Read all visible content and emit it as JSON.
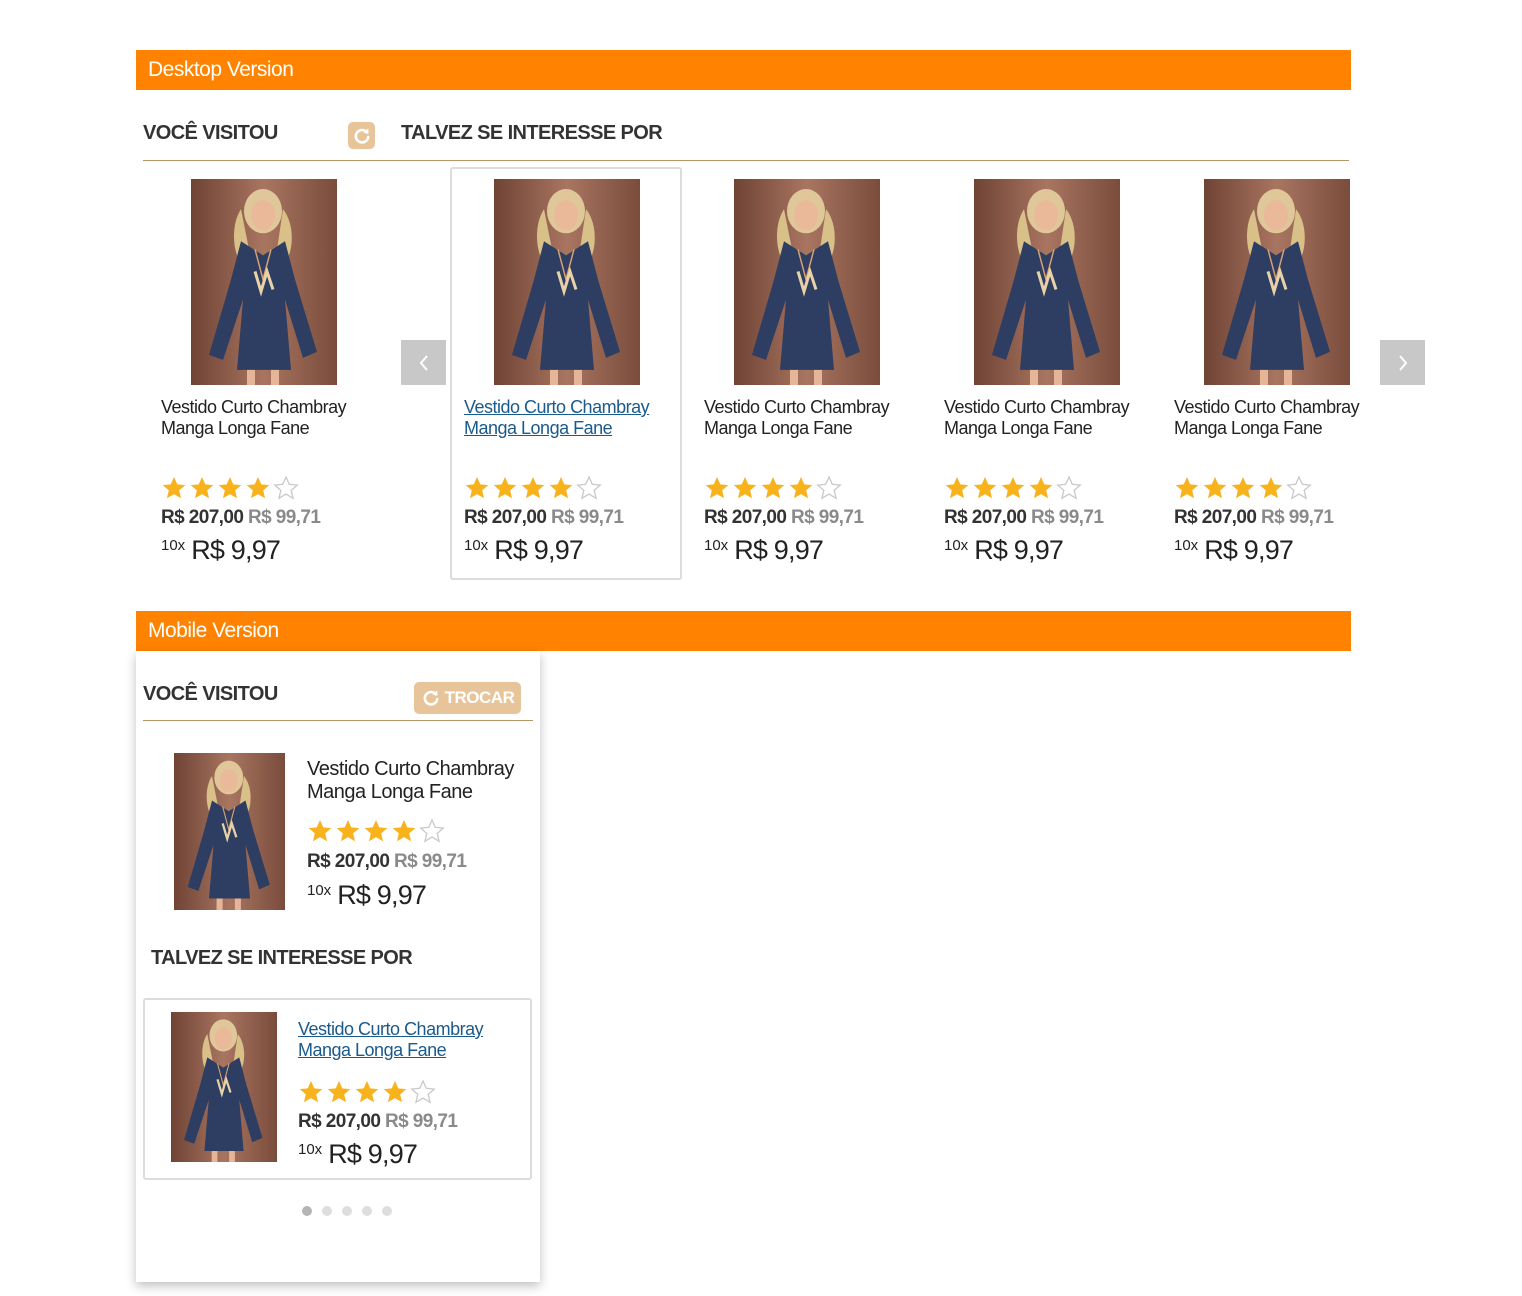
{
  "desktop": {
    "banner": "Desktop Version",
    "visited_heading": "VOCÊ VISITOU",
    "suggest_heading": "TALVEZ SE INTERESSE POR",
    "refresh_icon": "refresh-icon",
    "prev_icon": "chevron-left-icon",
    "next_icon": "chevron-right-icon",
    "products": [
      {
        "name_line1": "Vestido Curto Chambray",
        "name_line2": "Manga Longa Fane",
        "rating": 4,
        "price_old": "R$ 207,00",
        "price_new": "R$ 99,71",
        "installments": "10x",
        "installment_value": "R$ 9,97"
      },
      {
        "name_line1": "Vestido Curto Chambray",
        "name_line2": "Manga Longa Fane",
        "rating": 4,
        "price_old": "R$ 207,00",
        "price_new": "R$ 99,71",
        "installments": "10x",
        "installment_value": "R$ 9,97"
      },
      {
        "name_line1": "Vestido Curto Chambray",
        "name_line2": "Manga Longa Fane",
        "rating": 4,
        "price_old": "R$ 207,00",
        "price_new": "R$ 99,71",
        "installments": "10x",
        "installment_value": "R$ 9,97"
      },
      {
        "name_line1": "Vestido Curto Chambray",
        "name_line2": "Manga Longa Fane",
        "rating": 4,
        "price_old": "R$ 207,00",
        "price_new": "R$ 99,71",
        "installments": "10x",
        "installment_value": "R$ 9,97"
      },
      {
        "name_line1": "Vestido Curto Chambray",
        "name_line2": "Manga Longa Fane",
        "rating": 4,
        "price_old": "R$ 207,00",
        "price_new": "R$ 99,71",
        "installments": "10x",
        "installment_value": "R$ 9,97"
      }
    ]
  },
  "mobile": {
    "banner": "Mobile Version",
    "visited_heading": "VOCÊ VISITOU",
    "trocar_label": "TROCAR",
    "suggest_heading": "TALVEZ SE INTERESSE POR",
    "visited_product": {
      "name_line1": "Vestido Curto Chambray",
      "name_line2": "Manga Longa Fane",
      "rating": 4,
      "price_old": "R$ 207,00",
      "price_new": "R$ 99,71",
      "installments": "10x",
      "installment_value": "R$ 9,97"
    },
    "suggested_product": {
      "name_line1": "Vestido Curto Chambray",
      "name_line2": "Manga Longa Fane",
      "rating": 4,
      "price_old": "R$ 207,00",
      "price_new": "R$ 99,71",
      "installments": "10x",
      "installment_value": "R$ 9,97"
    },
    "carousel": {
      "total": 5,
      "active": 1
    }
  },
  "colors": {
    "banner": "#ff8300",
    "refresh_button": "#e8c49a",
    "star": "#f7b21c",
    "link": "#1a5a8c"
  }
}
